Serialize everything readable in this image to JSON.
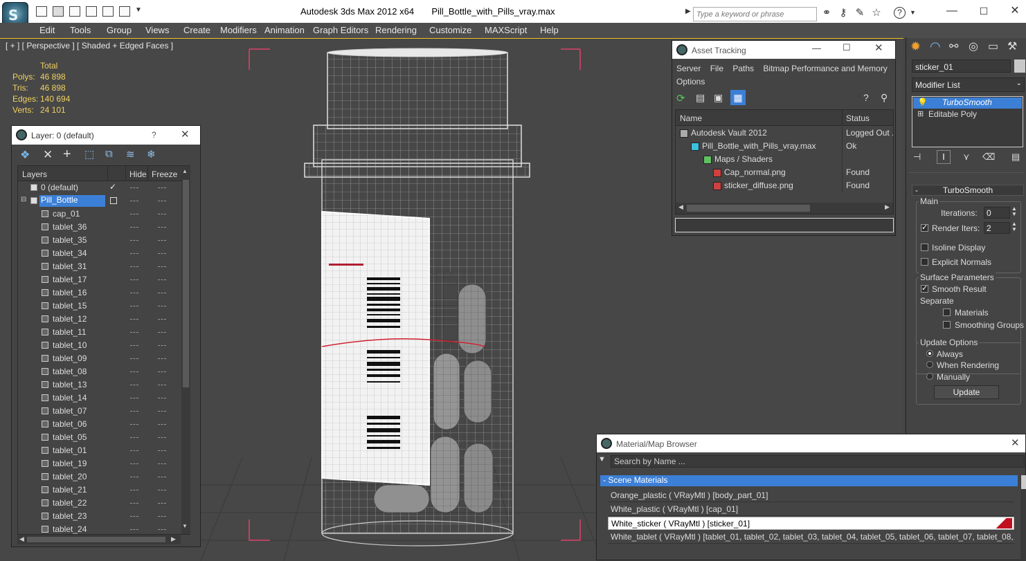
{
  "window": {
    "app_title": "Autodesk 3ds Max  2012 x64",
    "file_title": "Pill_Bottle_with_Pills_vray.max",
    "search_placeholder": "Type a keyword or phrase"
  },
  "menu": [
    "Edit",
    "Tools",
    "Group",
    "Views",
    "Create",
    "Modifiers",
    "Animation",
    "Graph Editors",
    "Rendering",
    "Customize",
    "MAXScript",
    "Help"
  ],
  "viewport": {
    "label": "[ + ] [ Perspective ] [ Shaded + Edged Faces ]",
    "stats": {
      "header": "Total",
      "polys_label": "Polys:",
      "polys": "46 898",
      "tris_label": "Tris:",
      "tris": "46 898",
      "edges_label": "Edges:",
      "edges": "140 694",
      "verts_label": "Verts:",
      "verts": "24 101"
    }
  },
  "layer_panel": {
    "title": "Layer: 0 (default)",
    "help": "?",
    "columns": {
      "layers": "Layers",
      "hide": "Hide",
      "freeze": "Freeze"
    },
    "rows": [
      {
        "label": "0 (default)",
        "type": "layer",
        "check": "✓"
      },
      {
        "label": "Pill_Bottle",
        "type": "layer-active"
      },
      {
        "label": "cap_01",
        "type": "obj"
      },
      {
        "label": "tablet_36",
        "type": "obj"
      },
      {
        "label": "tablet_35",
        "type": "obj"
      },
      {
        "label": "tablet_34",
        "type": "obj"
      },
      {
        "label": "tablet_31",
        "type": "obj"
      },
      {
        "label": "tablet_17",
        "type": "obj"
      },
      {
        "label": "tablet_16",
        "type": "obj"
      },
      {
        "label": "tablet_15",
        "type": "obj"
      },
      {
        "label": "tablet_12",
        "type": "obj"
      },
      {
        "label": "tablet_11",
        "type": "obj"
      },
      {
        "label": "tablet_10",
        "type": "obj"
      },
      {
        "label": "tablet_09",
        "type": "obj"
      },
      {
        "label": "tablet_08",
        "type": "obj"
      },
      {
        "label": "tablet_13",
        "type": "obj"
      },
      {
        "label": "tablet_14",
        "type": "obj"
      },
      {
        "label": "tablet_07",
        "type": "obj"
      },
      {
        "label": "tablet_06",
        "type": "obj"
      },
      {
        "label": "tablet_05",
        "type": "obj"
      },
      {
        "label": "tablet_01",
        "type": "obj"
      },
      {
        "label": "tablet_19",
        "type": "obj"
      },
      {
        "label": "tablet_20",
        "type": "obj"
      },
      {
        "label": "tablet_21",
        "type": "obj"
      },
      {
        "label": "tablet_22",
        "type": "obj"
      },
      {
        "label": "tablet_23",
        "type": "obj"
      },
      {
        "label": "tablet_24",
        "type": "obj"
      }
    ]
  },
  "asset_tracking": {
    "title": "Asset Tracking",
    "menu": [
      "Server",
      "File",
      "Paths",
      "Bitmap Performance and Memory",
      "Options"
    ],
    "columns": {
      "name": "Name",
      "status": "Status"
    },
    "rows": [
      {
        "name": "Autodesk Vault 2012",
        "status": "Logged Out ..."
      },
      {
        "name": "Pill_Bottle_with_Pills_vray.max",
        "status": "Ok"
      },
      {
        "name": "Maps / Shaders",
        "status": ""
      },
      {
        "name": "Cap_normal.png",
        "status": "Found"
      },
      {
        "name": "sticker_diffuse.png",
        "status": "Found"
      }
    ]
  },
  "command_panel": {
    "object_name": "sticker_01",
    "modifier_list": "Modifier List",
    "stack": [
      {
        "label": "TurboSmooth",
        "selected": true
      },
      {
        "label": "Editable Poly",
        "selected": false
      }
    ],
    "rollout_title": "TurboSmooth",
    "main_group": "Main",
    "iterations_label": "Iterations:",
    "iterations_value": "0",
    "render_iters_label": "Render Iters:",
    "render_iters_value": "2",
    "isoline_label": "Isoline Display",
    "explicit_normals_label": "Explicit Normals",
    "surface_params_group": "Surface Parameters",
    "smooth_result_label": "Smooth Result",
    "separate_label": "Separate",
    "materials_label": "Materials",
    "smoothing_groups_label": "Smoothing Groups",
    "update_options_group": "Update Options",
    "always_label": "Always",
    "when_rendering_label": "When Rendering",
    "manually_label": "Manually",
    "update_button": "Update"
  },
  "material_browser": {
    "title": "Material/Map Browser",
    "search_placeholder": "Search by Name ...",
    "group_label": "- Scene Materials",
    "materials": [
      {
        "label": "Orange_plastic  ( VRayMtl )  [body_part_01]",
        "selected": false
      },
      {
        "label": "White_plastic  ( VRayMtl )  [cap_01]",
        "selected": false
      },
      {
        "label": "White_sticker  ( VRayMtl )  [sticker_01]",
        "selected": true
      },
      {
        "label": "White_tablet  ( VRayMtl )  [tablet_01, tablet_02, tablet_03, tablet_04, tablet_05, tablet_06, tablet_07, tablet_08,...",
        "selected": false
      }
    ]
  },
  "colors": {
    "accent_blue": "#3c7fd6",
    "stats_yellow": "#f0d060",
    "selection_pink": "#e0406a"
  }
}
